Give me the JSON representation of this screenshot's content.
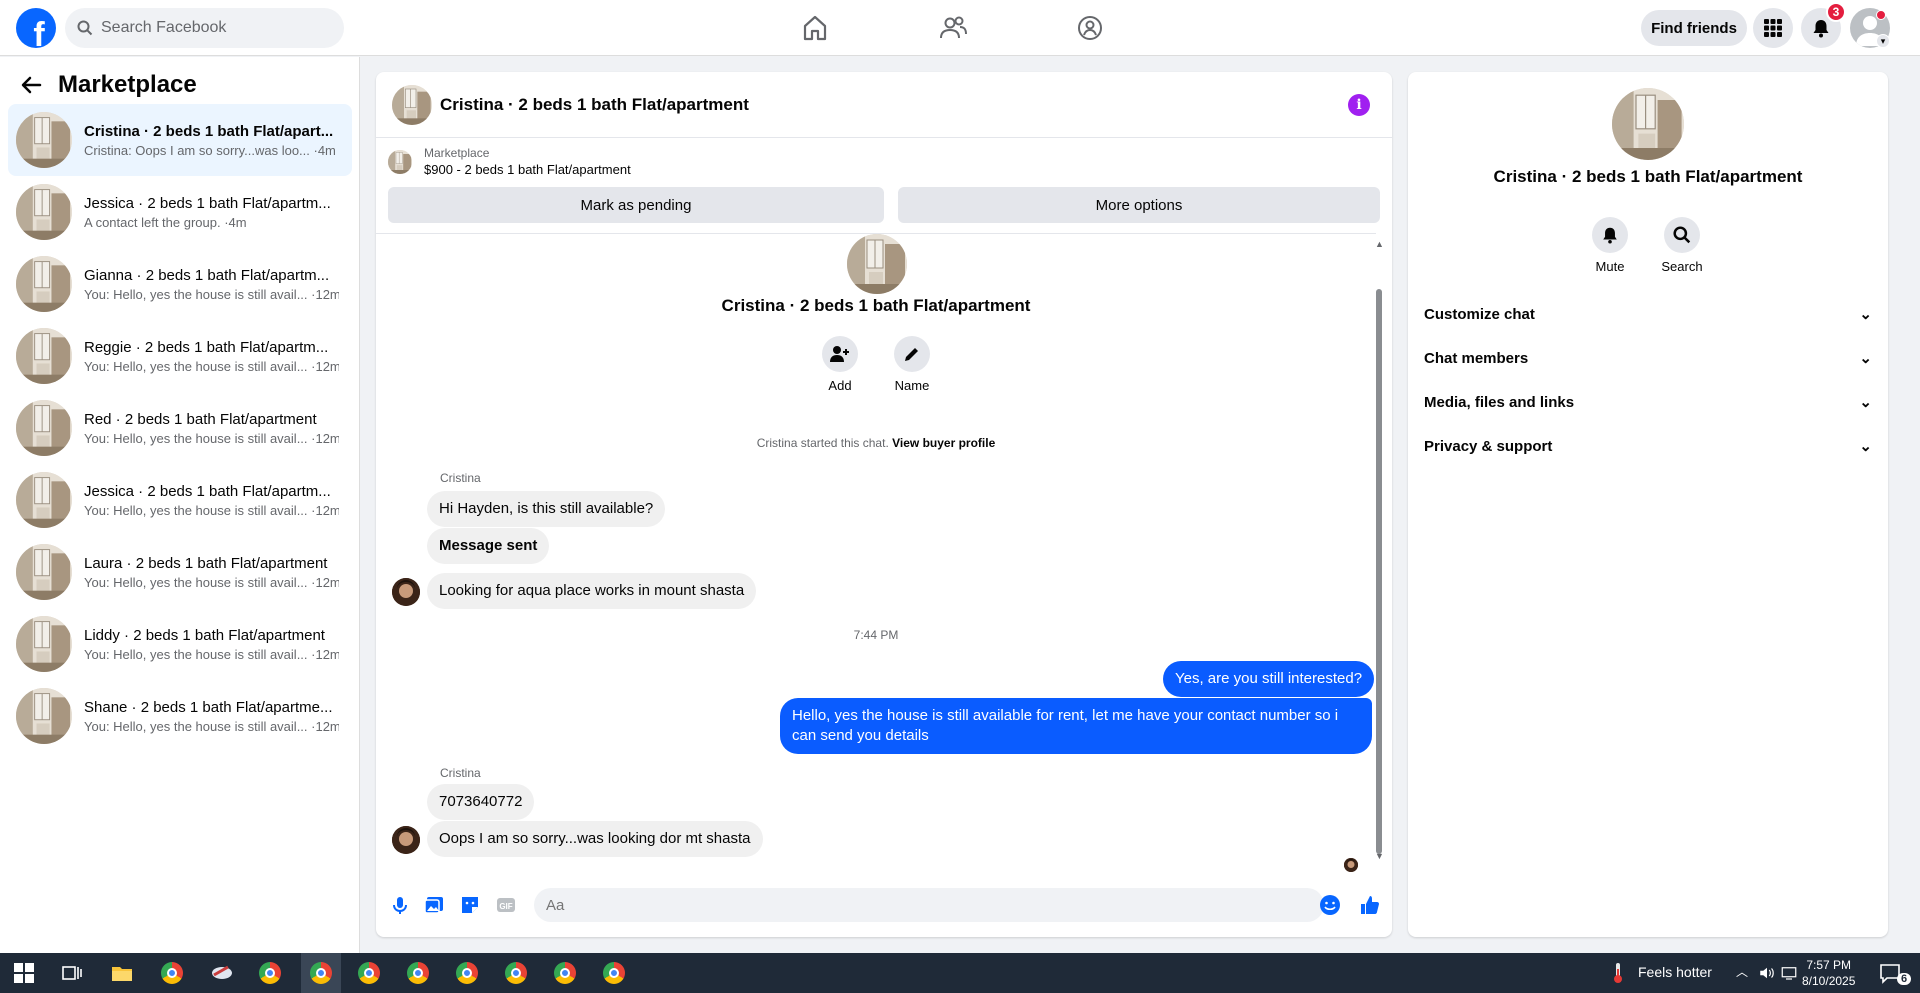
{
  "topbar": {
    "logo": "f",
    "search_placeholder": "Search Facebook",
    "find_friends": "Find friends",
    "notification_count": "3"
  },
  "sidebar": {
    "title": "Marketplace",
    "conversations": [
      {
        "name": "Cristina · 2 beds 1 bath Flat/apart...",
        "preview": "Cristina: Oops I am so sorry...was loo... ·4m"
      },
      {
        "name": "Jessica · 2 beds 1 bath Flat/apartm...",
        "preview": "A contact left the group. ·4m"
      },
      {
        "name": "Gianna · 2 beds 1 bath Flat/apartm...",
        "preview": "You: Hello, yes the house is still avail... ·12m"
      },
      {
        "name": "Reggie · 2 beds 1 bath Flat/apartm...",
        "preview": "You: Hello, yes the house is still avail... ·12m"
      },
      {
        "name": "Red · 2 beds 1 bath Flat/apartment",
        "preview": "You: Hello, yes the house is still avail... ·12m"
      },
      {
        "name": "Jessica · 2 beds 1 bath Flat/apartm...",
        "preview": "You: Hello, yes the house is still avail... ·12m"
      },
      {
        "name": "Laura · 2 beds 1 bath Flat/apartment",
        "preview": "You: Hello, yes the house is still avail... ·12m"
      },
      {
        "name": "Liddy · 2 beds 1 bath Flat/apartment",
        "preview": "You: Hello, yes the house is still avail... ·12m"
      },
      {
        "name": "Shane · 2 beds 1 bath Flat/apartme...",
        "preview": "You: Hello, yes the house is still avail... ·12m"
      }
    ]
  },
  "chat": {
    "title": "Cristina · 2 beds 1 bath Flat/apartment",
    "listing_source": "Marketplace",
    "listing_price": "$900 - 2 beds 1 bath Flat/apartment",
    "mark_pending": "Mark as pending",
    "more_options": "More options",
    "thread_title": "Cristina · 2 beds 1 bath Flat/apartment",
    "add_label": "Add",
    "name_label": "Name",
    "started_note": "Cristina started this chat.",
    "view_profile": "View buyer profile",
    "sender_1": "Cristina",
    "msg_1": "Hi Hayden, is this still available?",
    "msg_2": "Message sent",
    "msg_3": "Looking for aqua place works in mount shasta",
    "time_1": "7:44 PM",
    "msg_4": "Yes, are you still interested?",
    "msg_5_line1": "Hello, yes the house is still available for rent, let me have your contact number so i",
    "msg_5_line2": "can send you details",
    "sender_2": "Cristina",
    "msg_6": "7073640772",
    "msg_7": "Oops I am so sorry...was looking dor mt shasta",
    "composer_placeholder": "Aa"
  },
  "rpanel": {
    "title": "Cristina · 2 beds 1 bath Flat/apartment",
    "mute": "Mute",
    "search": "Search",
    "sections": [
      "Customize chat",
      "Chat members",
      "Media, files and links",
      "Privacy & support"
    ]
  },
  "taskbar": {
    "weather": "Feels hotter",
    "time": "7:57 PM",
    "date": "8/10/2025",
    "notif_count": "6"
  },
  "colors": {
    "brand": "#0866ff",
    "my_bubble": "#0a5cff",
    "info": "#a020f0",
    "badge": "#e41e3f"
  }
}
